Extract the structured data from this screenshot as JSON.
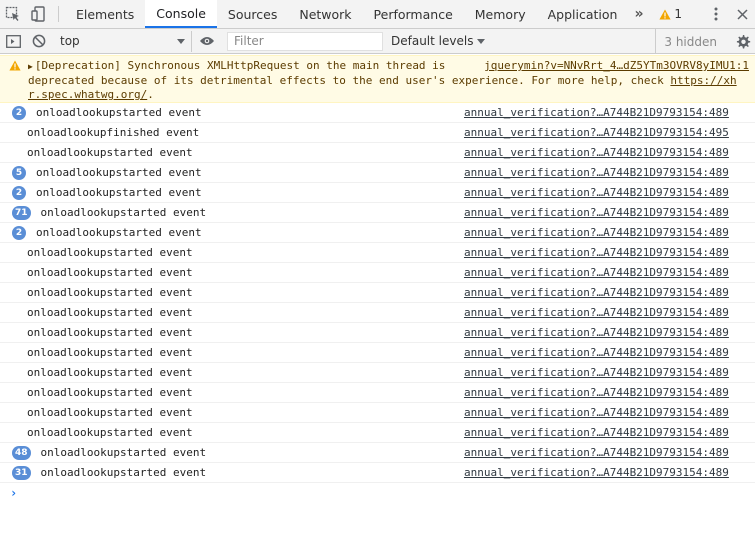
{
  "tabs": [
    {
      "label": "Elements",
      "active": false
    },
    {
      "label": "Console",
      "active": true
    },
    {
      "label": "Sources",
      "active": false
    },
    {
      "label": "Network",
      "active": false
    },
    {
      "label": "Performance",
      "active": false
    },
    {
      "label": "Memory",
      "active": false
    },
    {
      "label": "Application",
      "active": false
    }
  ],
  "more_tabs": "»",
  "warning_count": "1",
  "toolbar": {
    "context": "top",
    "filter_placeholder": "Filter",
    "levels": "Default levels",
    "hidden": "3 hidden"
  },
  "colors": {
    "accent": "#1a73e8",
    "badge": "#5a8ed6",
    "warning_bg": "#fffbe5",
    "warning_text": "#5c3c00"
  },
  "warning_message": {
    "line1": "[Deprecation] Synchronous XMLHttpRequest on the main thread is",
    "source": "jquerymin?v=NNvRrt_4…dZ5YTm3OVRV8yIMU1:1",
    "line2": "deprecated because of its detrimental effects to the end user's experience. For more help, check ",
    "link_a": "https://xh",
    "link_b": "r.spec.whatwg.org/",
    "line3_end": "."
  },
  "messages": [
    {
      "count": "2",
      "text": "onloadlookupstarted event",
      "source": "annual_verification?…A744B21D9793154:489"
    },
    {
      "count": "",
      "text": "onloadlookupfinished event",
      "source": "annual_verification?…A744B21D9793154:495"
    },
    {
      "count": "",
      "text": "onloadlookupstarted event",
      "source": "annual_verification?…A744B21D9793154:489"
    },
    {
      "count": "5",
      "text": "onloadlookupstarted event",
      "source": "annual_verification?…A744B21D9793154:489"
    },
    {
      "count": "2",
      "text": "onloadlookupstarted event",
      "source": "annual_verification?…A744B21D9793154:489"
    },
    {
      "count": "71",
      "text": "onloadlookupstarted event",
      "source": "annual_verification?…A744B21D9793154:489"
    },
    {
      "count": "2",
      "text": "onloadlookupstarted event",
      "source": "annual_verification?…A744B21D9793154:489"
    },
    {
      "count": "",
      "text": "onloadlookupstarted event",
      "source": "annual_verification?…A744B21D9793154:489"
    },
    {
      "count": "",
      "text": "onloadlookupstarted event",
      "source": "annual_verification?…A744B21D9793154:489"
    },
    {
      "count": "",
      "text": "onloadlookupstarted event",
      "source": "annual_verification?…A744B21D9793154:489"
    },
    {
      "count": "",
      "text": "onloadlookupstarted event",
      "source": "annual_verification?…A744B21D9793154:489"
    },
    {
      "count": "",
      "text": "onloadlookupstarted event",
      "source": "annual_verification?…A744B21D9793154:489"
    },
    {
      "count": "",
      "text": "onloadlookupstarted event",
      "source": "annual_verification?…A744B21D9793154:489"
    },
    {
      "count": "",
      "text": "onloadlookupstarted event",
      "source": "annual_verification?…A744B21D9793154:489"
    },
    {
      "count": "",
      "text": "onloadlookupstarted event",
      "source": "annual_verification?…A744B21D9793154:489"
    },
    {
      "count": "",
      "text": "onloadlookupstarted event",
      "source": "annual_verification?…A744B21D9793154:489"
    },
    {
      "count": "",
      "text": "onloadlookupstarted event",
      "source": "annual_verification?…A744B21D9793154:489"
    },
    {
      "count": "48",
      "text": "onloadlookupstarted event",
      "source": "annual_verification?…A744B21D9793154:489"
    },
    {
      "count": "31",
      "text": "onloadlookupstarted event",
      "source": "annual_verification?…A744B21D9793154:489"
    }
  ],
  "prompt_symbol": "›"
}
